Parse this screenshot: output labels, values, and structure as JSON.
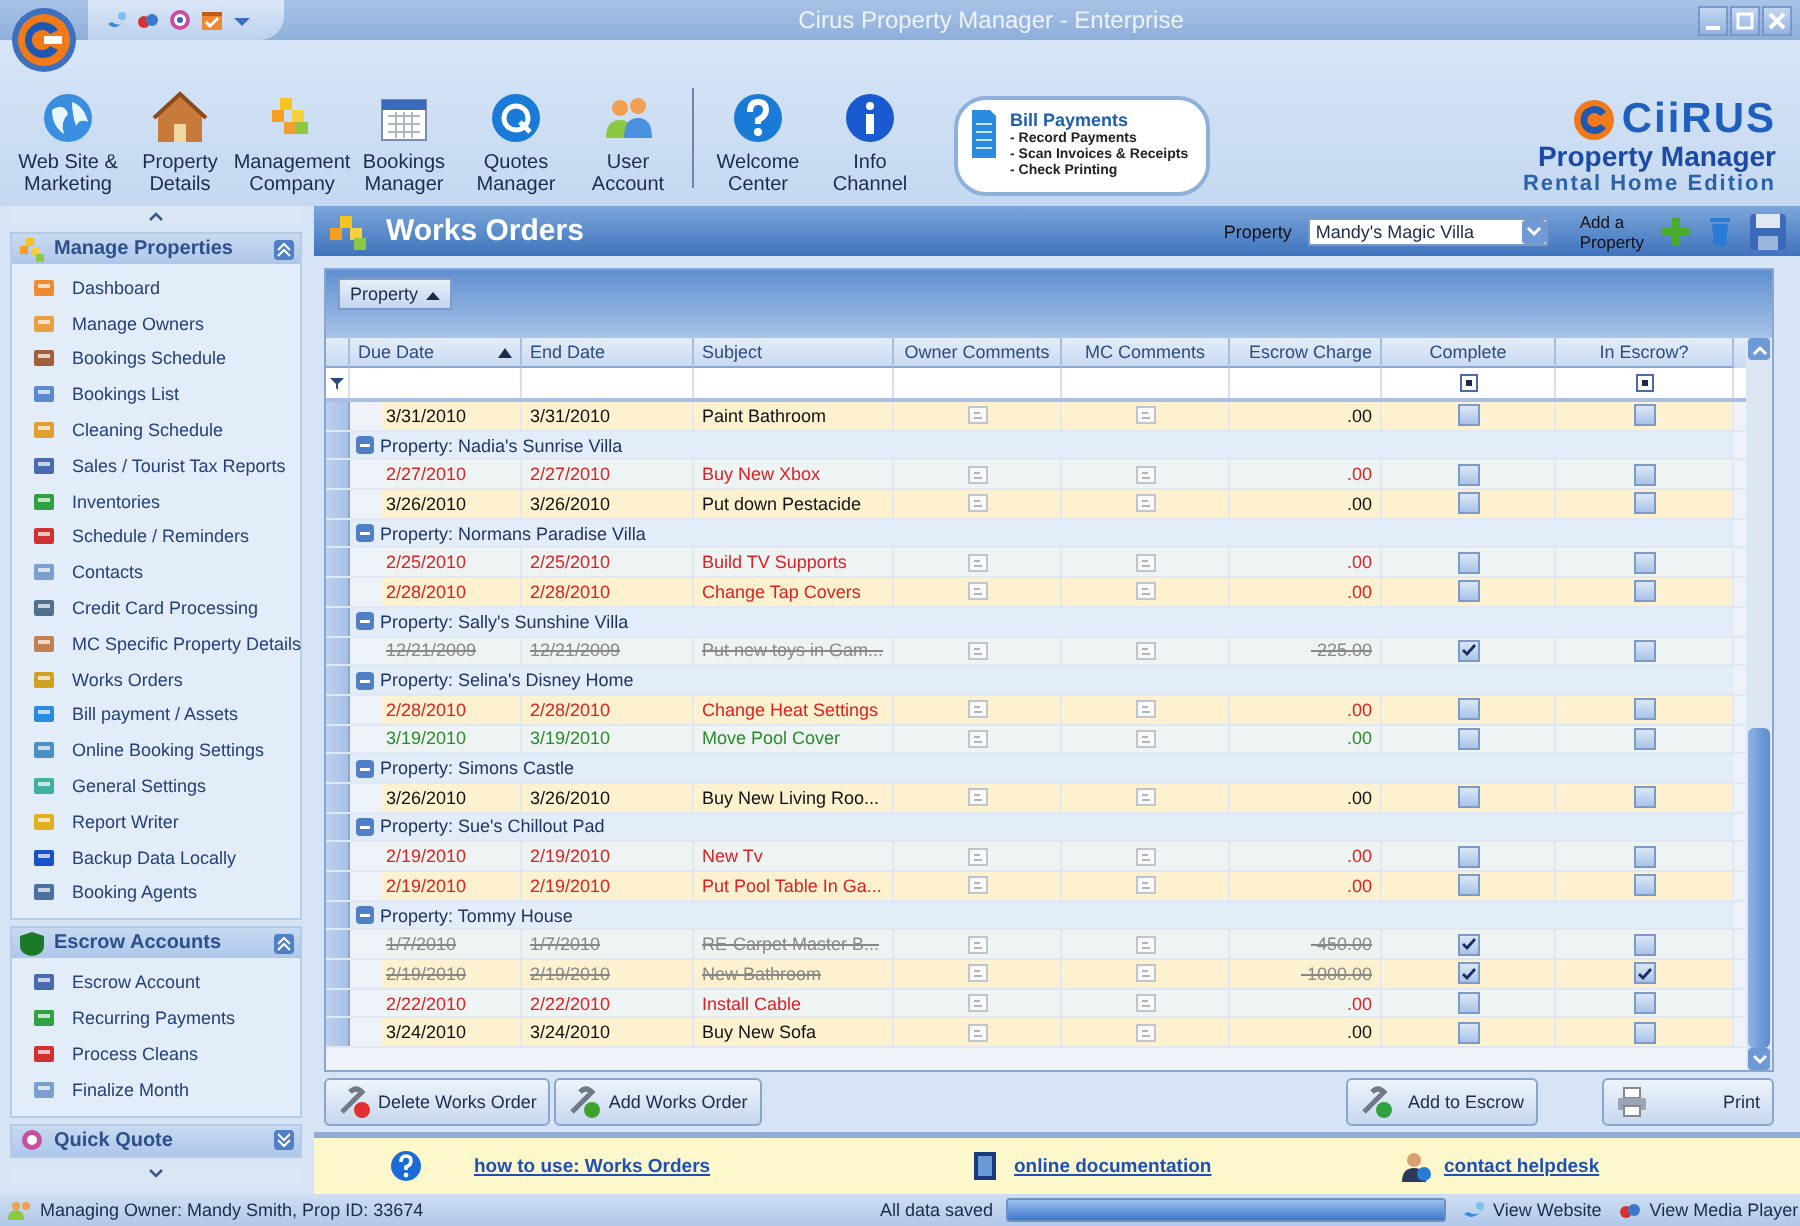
{
  "window": {
    "title": "Cirus Property Manager  - Enterprise"
  },
  "toolbar": [
    {
      "label": "Web Site &\nMarketing"
    },
    {
      "label": "Property\nDetails"
    },
    {
      "label": "Management\nCompany"
    },
    {
      "label": "Bookings\nManager"
    },
    {
      "label": "Quotes\nManager"
    },
    {
      "label": "User\nAccount"
    },
    {
      "label": "Welcome\nCenter"
    },
    {
      "label": "Info\nChannel"
    }
  ],
  "promo": {
    "title": "Bill Payments",
    "lines": [
      "- Record Payments",
      "- Scan Invoices & Receipts",
      "- Check Printing"
    ]
  },
  "logo": {
    "brand": "CiiRUS",
    "product": "Property Manager",
    "edition": "Rental Home Edition"
  },
  "sidebar": {
    "sections": [
      {
        "title": "Manage Properties",
        "expanded": true,
        "items": [
          "Dashboard",
          "Manage Owners",
          "Bookings Schedule",
          "Bookings List",
          "Cleaning Schedule",
          "Sales / Tourist Tax Reports",
          "Inventories",
          "Schedule / Reminders",
          "Contacts",
          "Credit Card Processing",
          "MC Specific Property Details",
          "Works Orders",
          "Bill payment / Assets",
          "Online Booking Settings",
          "General Settings",
          "Report Writer",
          "Backup Data Locally",
          "Booking Agents"
        ]
      },
      {
        "title": "Escrow Accounts",
        "expanded": true,
        "items": [
          "Escrow Account",
          "Recurring Payments",
          "Process Cleans",
          "Finalize Month"
        ]
      },
      {
        "title": "Quick Quote",
        "expanded": false
      }
    ]
  },
  "page": {
    "title": "Works Orders",
    "property_label": "Property",
    "property_value": "Mandy's Magic Villa",
    "add_property": "Add a\nProperty"
  },
  "grid": {
    "group_by": "Property",
    "columns": [
      {
        "label": "Due Date",
        "sorted": true
      },
      {
        "label": "End Date",
        "sorted": false
      },
      {
        "label": "Subject",
        "sorted": false
      },
      {
        "label": "Owner Comments",
        "sorted": false
      },
      {
        "label": "MC Comments",
        "sorted": false
      },
      {
        "label": "Escrow Charge",
        "sorted": false
      },
      {
        "label": "Complete",
        "sorted": false
      },
      {
        "label": "In Escrow?",
        "sorted": false
      }
    ],
    "rows": [
      {
        "kind": "item",
        "color": "#111111",
        "due": "3/31/2010",
        "end": "3/31/2010",
        "subject": "Paint Bathroom",
        "charge": ".00",
        "complete": false,
        "in_escrow": false
      },
      {
        "kind": "group",
        "label": "Property: Nadia's Sunrise Villa"
      },
      {
        "kind": "item",
        "color": "#e02020",
        "due": "2/27/2010",
        "end": "2/27/2010",
        "subject": "Buy New Xbox",
        "charge": ".00",
        "complete": false,
        "in_escrow": false
      },
      {
        "kind": "item",
        "color": "#111111",
        "due": "3/26/2010",
        "end": "3/26/2010",
        "subject": "Put down Pestacide",
        "charge": ".00",
        "complete": false,
        "in_escrow": false
      },
      {
        "kind": "group",
        "label": "Property: Normans Paradise Villa"
      },
      {
        "kind": "item",
        "color": "#e02020",
        "due": "2/25/2010",
        "end": "2/25/2010",
        "subject": "Build TV Supports",
        "charge": ".00",
        "complete": false,
        "in_escrow": false
      },
      {
        "kind": "item",
        "color": "#e02020",
        "due": "2/28/2010",
        "end": "2/28/2010",
        "subject": "Change Tap Covers",
        "charge": ".00",
        "complete": false,
        "in_escrow": false
      },
      {
        "kind": "group",
        "label": "Property: Sally's Sunshine Villa"
      },
      {
        "kind": "item",
        "color": "#888888",
        "due": "12/21/2009",
        "end": "12/21/2009",
        "subject": "Put new toys in Gam...",
        "charge": "-225.00",
        "complete": true,
        "in_escrow": false
      },
      {
        "kind": "group",
        "label": "Property: Selina's Disney Home"
      },
      {
        "kind": "item",
        "color": "#e02020",
        "due": "2/28/2010",
        "end": "2/28/2010",
        "subject": "Change Heat Settings",
        "charge": ".00",
        "complete": false,
        "in_escrow": false
      },
      {
        "kind": "item",
        "color": "#2a8a2a",
        "due": "3/19/2010",
        "end": "3/19/2010",
        "subject": "Move Pool Cover",
        "charge": ".00",
        "complete": false,
        "in_escrow": false
      },
      {
        "kind": "group",
        "label": "Property: Simons Castle"
      },
      {
        "kind": "item",
        "color": "#111111",
        "due": "3/26/2010",
        "end": "3/26/2010",
        "subject": "Buy New Living Roo...",
        "charge": ".00",
        "complete": false,
        "in_escrow": false
      },
      {
        "kind": "group",
        "label": "Property: Sue's Chillout Pad"
      },
      {
        "kind": "item",
        "color": "#e02020",
        "due": "2/19/2010",
        "end": "2/19/2010",
        "subject": "New Tv",
        "charge": ".00",
        "complete": false,
        "in_escrow": false
      },
      {
        "kind": "item",
        "color": "#e02020",
        "due": "2/19/2010",
        "end": "2/19/2010",
        "subject": "Put Pool Table In Ga...",
        "charge": ".00",
        "complete": false,
        "in_escrow": false
      },
      {
        "kind": "group",
        "label": "Property: Tommy House"
      },
      {
        "kind": "item",
        "color": "#888888",
        "due": "1/7/2010",
        "end": "1/7/2010",
        "subject": "RE-Carpet Master B...",
        "charge": "-450.00",
        "complete": true,
        "in_escrow": false
      },
      {
        "kind": "item",
        "color": "#888888",
        "due": "2/19/2010",
        "end": "2/19/2010",
        "subject": "New Bathroom",
        "charge": "-1000.00",
        "complete": true,
        "in_escrow": true
      },
      {
        "kind": "item",
        "color": "#e02020",
        "due": "2/22/2010",
        "end": "2/22/2010",
        "subject": "Install Cable",
        "charge": ".00",
        "complete": false,
        "in_escrow": false
      },
      {
        "kind": "item",
        "color": "#111111",
        "due": "3/24/2010",
        "end": "3/24/2010",
        "subject": "Buy New Sofa",
        "charge": ".00",
        "complete": false,
        "in_escrow": false
      }
    ]
  },
  "buttons_left": [
    "Delete Works Order",
    "Add Works Order"
  ],
  "buttons_right": [
    "Add to Escrow",
    "Print"
  ],
  "help_links": [
    "how to use: Works Orders",
    "online documentation",
    "contact helpdesk"
  ],
  "status_bar": {
    "owner": "Managing Owner: Mandy Smith, Prop ID: 33674",
    "saved": "All data saved",
    "level": 1,
    "links": [
      "View Website",
      "View Media Player"
    ]
  }
}
